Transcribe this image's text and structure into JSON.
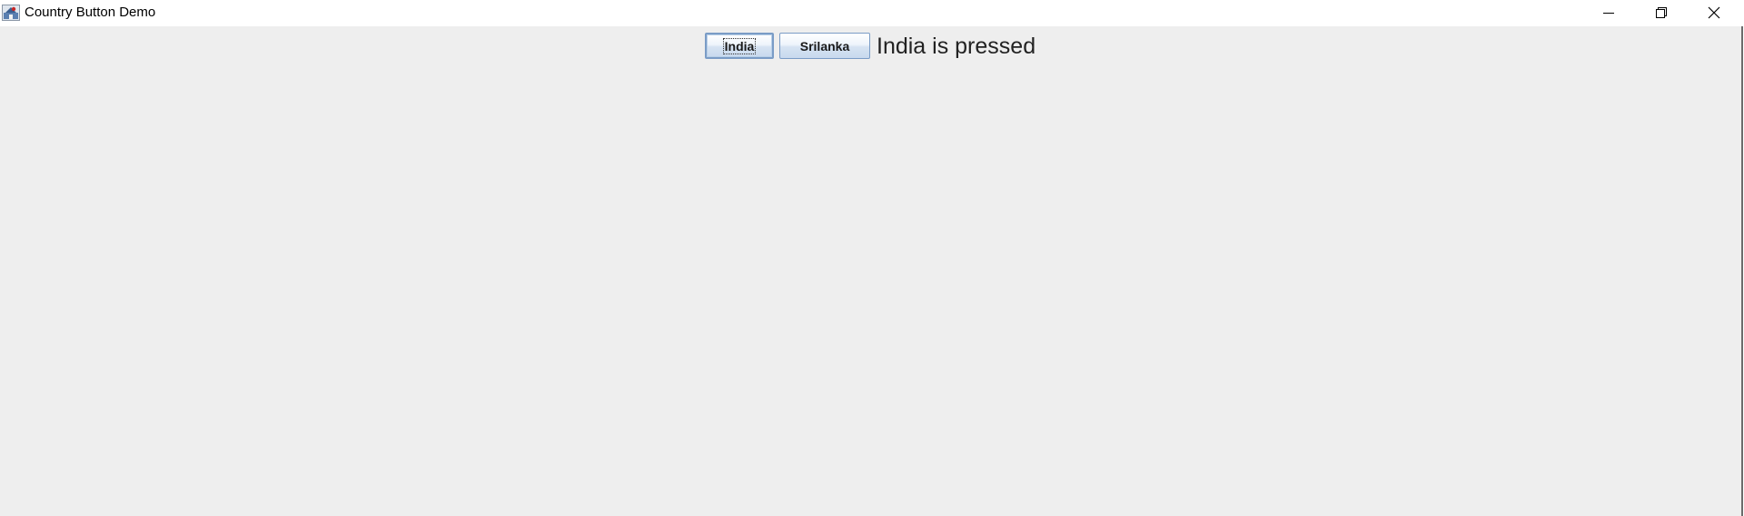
{
  "window": {
    "title": "Country Button Demo",
    "icon": "java-app-icon",
    "controls": {
      "minimize": "minimize-icon",
      "maximize": "restore-icon",
      "close": "close-icon"
    }
  },
  "buttons": {
    "india_label": "India",
    "srilanka_label": "Srilanka"
  },
  "status": {
    "text": "India is pressed"
  },
  "colors": {
    "content_background": "#eeeeee",
    "button_border": "#7a9cc6"
  }
}
